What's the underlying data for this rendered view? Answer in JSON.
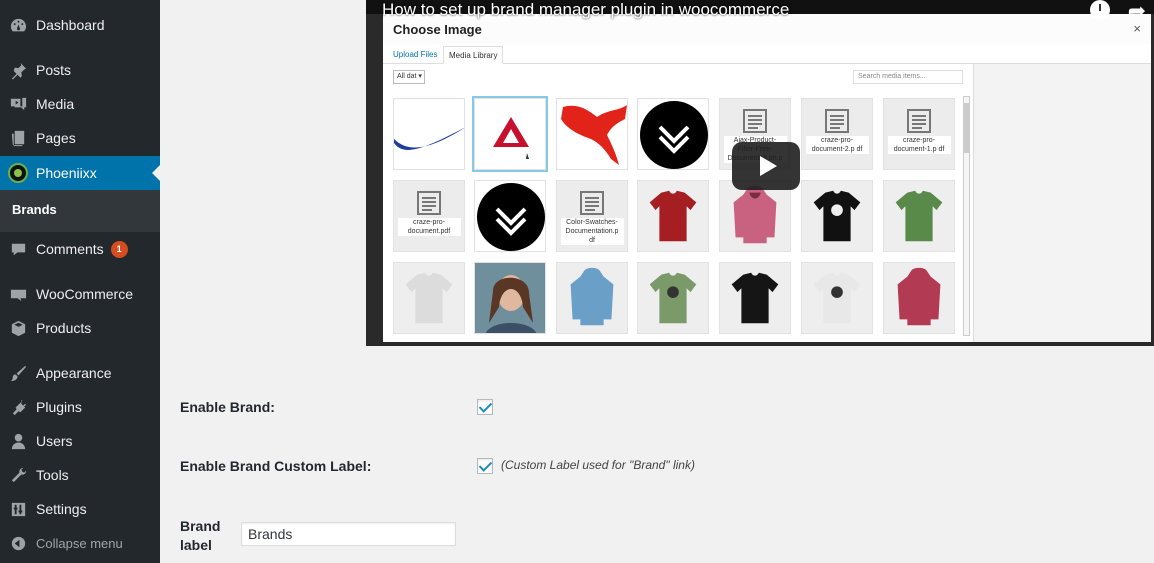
{
  "sidebar": {
    "items": [
      {
        "label": "Dashboard",
        "icon": "dashboard-icon"
      },
      {
        "label": "Posts",
        "icon": "pin-icon"
      },
      {
        "label": "Media",
        "icon": "media-icon"
      },
      {
        "label": "Pages",
        "icon": "pages-icon"
      },
      {
        "label": "Phoeniixx",
        "icon": "phoeniixx-logo-icon"
      },
      {
        "label": "Comments",
        "icon": "comment-icon",
        "badge": "1"
      },
      {
        "label": "WooCommerce",
        "icon": "woo-icon"
      },
      {
        "label": "Products",
        "icon": "cube-icon"
      },
      {
        "label": "Appearance",
        "icon": "brush-icon"
      },
      {
        "label": "Plugins",
        "icon": "plug-icon"
      },
      {
        "label": "Users",
        "icon": "user-icon"
      },
      {
        "label": "Tools",
        "icon": "wrench-icon"
      },
      {
        "label": "Settings",
        "icon": "sliders-icon"
      },
      {
        "label": "Collapse menu",
        "icon": "collapse-icon"
      }
    ],
    "submenu": {
      "label": "Brands"
    },
    "colors": {
      "background": "#23282d",
      "current": "#0073aa",
      "badge": "#d54e21"
    }
  },
  "video": {
    "title": "How to set up brand manager plugin in woocommerce",
    "modal": {
      "title": "Choose Image",
      "close": "×",
      "tabs": [
        "Upload Files",
        "Media Library"
      ],
      "filter_value": "All dat",
      "search_placeholder": "Search media items...",
      "documents": {
        "ajax": "Ajax-Product-Filter-Free-Documentati on.p",
        "craze2": "craze-pro-document-2.p df",
        "craze1": "craze-pro-document-1.p df",
        "craze": "craze-pro-document.pdf",
        "color": "Color-Swatches-Documentation.p df"
      }
    }
  },
  "form": {
    "enable_brand_label": "Enable Brand:",
    "enable_brand_checked": true,
    "enable_custom_label_label": "Enable Brand Custom Label:",
    "enable_custom_label_checked": true,
    "custom_label_description": "(Custom Label used for \"Brand\" link)",
    "brand_label_label_line1": "Brand",
    "brand_label_label_line2": "label",
    "brand_label_value": "Brands"
  }
}
